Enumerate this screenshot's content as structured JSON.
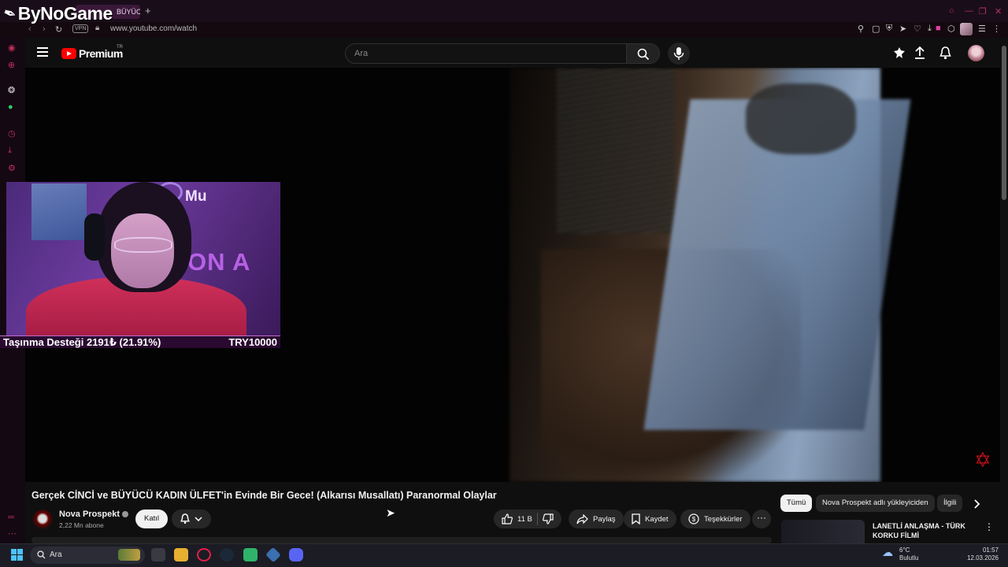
{
  "browser": {
    "brand": "ByNoGame",
    "tab_label": "BÜYÜCÜ",
    "tab_add": "+",
    "url": "www.youtube.com/watch",
    "vpn_badge": "VPN"
  },
  "youtube": {
    "logo": "Premium",
    "region": "TR",
    "search_placeholder": "Ara"
  },
  "overlay": {
    "webcam_sign": "Mu",
    "neon_text": "ON A",
    "goal_label": "Taşınma Desteği 2191₺ (21.91%)",
    "goal_target": "TRY10000"
  },
  "video": {
    "title": "Gerçek CİNCİ ve BÜYÜCÜ KADIN ÜLFET'in Evinde Bir Gece! (Alkarısı Musallatı) Paranormal Olaylar",
    "channel": "Nova Prospekt",
    "subscribers": "2,22 Mn abone",
    "join_label": "Katıl",
    "likes": "11 B",
    "share_label": "Paylaş",
    "save_label": "Kaydet",
    "thanks_label": "Teşekkürler",
    "more_label": "···"
  },
  "chips": [
    "Tümü",
    "Nova Prospekt adlı yükleyiciden",
    "İlgili"
  ],
  "recommendation": {
    "title": "LANETLİ ANLAŞMA - TÜRK KORKU FİLMİ",
    "more": "⋮"
  },
  "taskbar": {
    "search": "Ara",
    "temp": "6°C",
    "weather": "Bulutlu",
    "time": "01:57",
    "date": "12.03.2026"
  },
  "colors": {
    "accent": "#ff0000",
    "browser_bg": "#1a0d1a",
    "page_bg": "#0f0f0f",
    "chip_active": "#f1f1f1"
  },
  "icons": [
    "hamburger-icon",
    "search-icon",
    "mic-icon",
    "create-icon",
    "upload-icon",
    "bell-icon",
    "like-icon",
    "dislike-icon",
    "share-icon",
    "save-icon",
    "thanks-icon",
    "chevron-right-icon"
  ]
}
